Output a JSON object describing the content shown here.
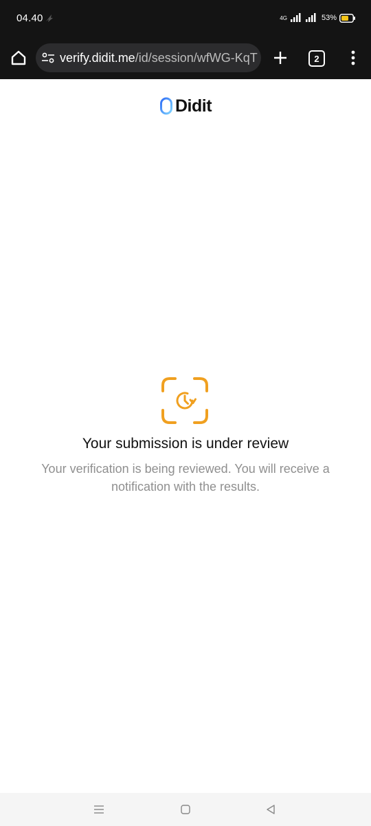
{
  "status_bar": {
    "time": "04.40",
    "network": "4G",
    "battery": "53%",
    "icons": [
      "notification-icon",
      "signal-icon",
      "signal-icon-2",
      "battery-icon"
    ]
  },
  "browser": {
    "url_host": "verify.didit.me",
    "url_path": "/id/session/wfWG-KqT",
    "tab_count": "2",
    "icons": [
      "home-icon",
      "tune-icon",
      "plus-icon",
      "more-vert-icon"
    ]
  },
  "page": {
    "logo_text": "Didit",
    "review_title": "Your submission is under review",
    "review_message": "Your verification is being reviewed. You will receive a notification with the results.",
    "accent_color": "#f0a020"
  },
  "nav_bar": {
    "icons": [
      "recents-icon",
      "home-square-icon",
      "back-icon"
    ]
  }
}
